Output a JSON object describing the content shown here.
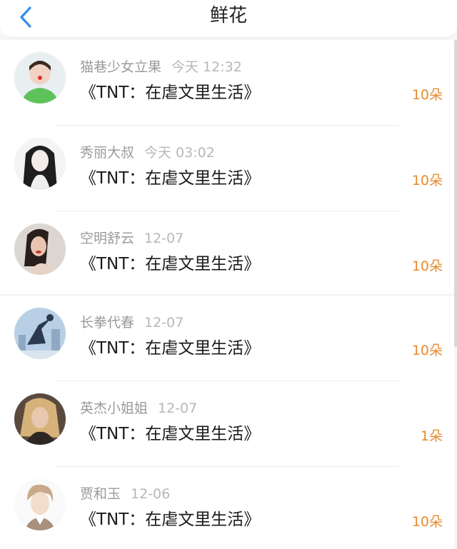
{
  "header": {
    "title": "鲜花",
    "back_icon": "chevron-left-icon",
    "accent": "#2f8ef0"
  },
  "list": {
    "count_color": "#e88a2e",
    "items": [
      {
        "name": "猫巷少女立果",
        "time": "今天 12:32",
        "book": "《TNT：在虐文里生活》",
        "count": "10朵",
        "avatar": "avatar-1"
      },
      {
        "name": "秀丽大叔",
        "time": "今天 03:02",
        "book": "《TNT：在虐文里生活》",
        "count": "10朵",
        "avatar": "avatar-2"
      },
      {
        "name": "空明舒云",
        "time": "12-07",
        "book": "《TNT：在虐文里生活》",
        "count": "10朵",
        "avatar": "avatar-3"
      },
      {
        "name": "长拳代春",
        "time": "12-07",
        "book": "《TNT：在虐文里生活》",
        "count": "10朵",
        "avatar": "avatar-4"
      },
      {
        "name": "英杰小姐姐",
        "time": "12-07",
        "book": "《TNT：在虐文里生活》",
        "count": "1朵",
        "avatar": "avatar-5"
      },
      {
        "name": "贾和玉",
        "time": "12-06",
        "book": "《TNT：在虐文里生活》",
        "count": "10朵",
        "avatar": "avatar-6"
      }
    ]
  }
}
